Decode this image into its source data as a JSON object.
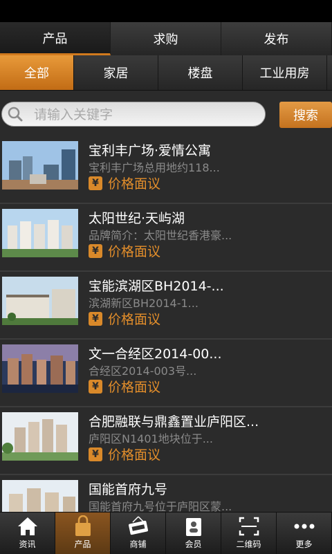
{
  "top_tabs": [
    {
      "label": "产品"
    },
    {
      "label": "求购"
    },
    {
      "label": "发布"
    }
  ],
  "category_tabs": [
    {
      "label": "全部"
    },
    {
      "label": "家居"
    },
    {
      "label": "楼盘"
    },
    {
      "label": "工业用房"
    }
  ],
  "search": {
    "placeholder": "请输入关键字",
    "button_label": "搜索"
  },
  "listings": [
    {
      "title": "宝利丰广场·爱情公寓",
      "desc": "宝利丰广场总用地约118...",
      "price": "价格面议"
    },
    {
      "title": "太阳世纪·天屿湖",
      "desc": "品牌简介：太阳世纪香港豪...",
      "price": "价格面议"
    },
    {
      "title": "宝能滨湖区BH2014-...",
      "desc": "滨湖新区BH2014-1...",
      "price": "价格面议"
    },
    {
      "title": "文一合经区2014-00...",
      "desc": "合经区2014-003号...",
      "price": "价格面议"
    },
    {
      "title": "合肥融联与鼎鑫置业庐阳区...",
      "desc": "庐阳区N1401地块位于...",
      "price": "价格面议"
    },
    {
      "title": "国能首府九号",
      "desc": "国能首府九号位于庐阳区蒙...",
      "price": ""
    }
  ],
  "currency_symbol": "¥",
  "bottom_nav": [
    {
      "label": "资讯",
      "icon": "home-icon"
    },
    {
      "label": "产品",
      "icon": "shopping-bag-icon"
    },
    {
      "label": "商铺",
      "icon": "open-sign-icon"
    },
    {
      "label": "会员",
      "icon": "member-card-icon"
    },
    {
      "label": "二维码",
      "icon": "qr-scan-icon"
    },
    {
      "label": "更多",
      "icon": "more-dots-icon"
    }
  ],
  "colors": {
    "accent": "#d27a1d",
    "price": "#e38e2b",
    "background": "#2b2b2b"
  }
}
